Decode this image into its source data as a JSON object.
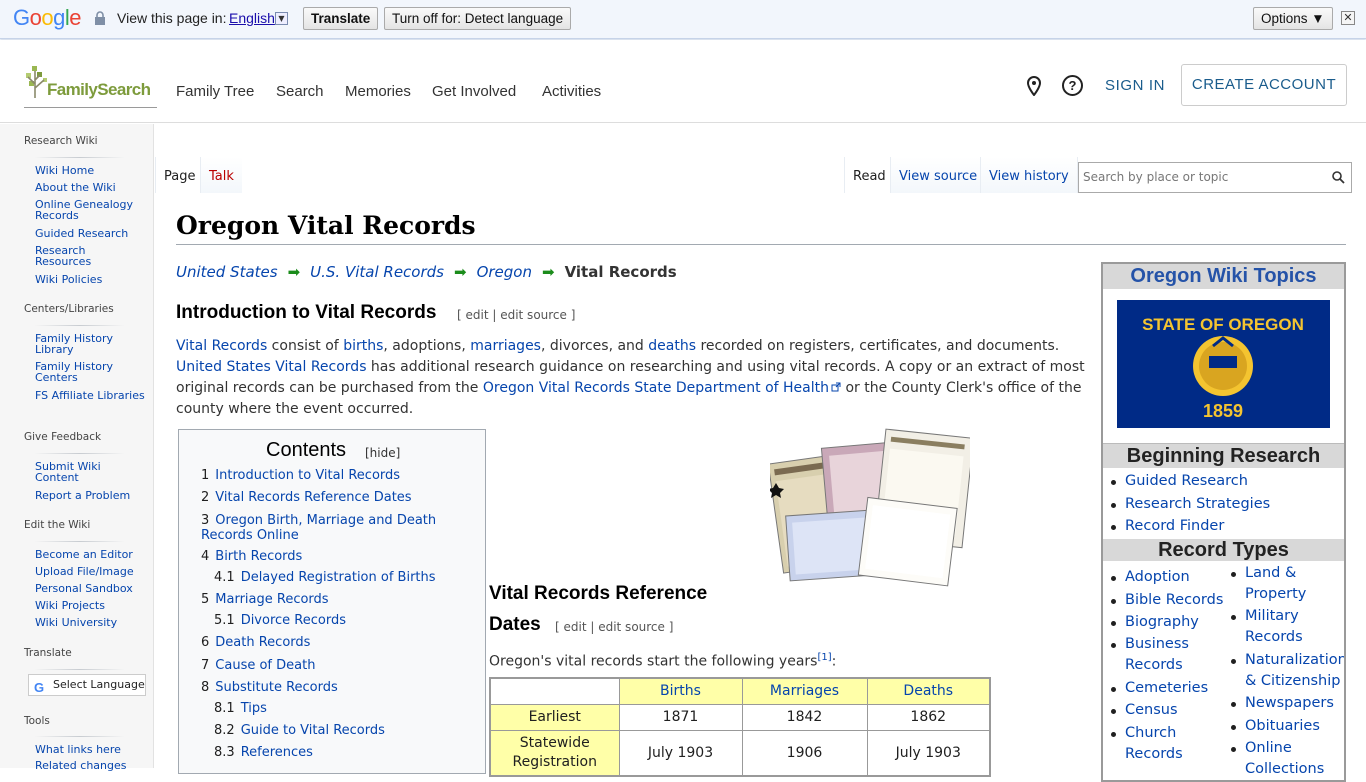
{
  "translate_bar": {
    "view_label": "View this page in:",
    "language": "English",
    "translate_button": "Translate",
    "turn_off_button": "Turn off for: Detect language",
    "options_button": "Options ▼",
    "close": "✕"
  },
  "header": {
    "logo_text": "FamilySearch",
    "nav": [
      "Family Tree",
      "Search",
      "Memories",
      "Get Involved",
      "Activities"
    ],
    "help": "?",
    "sign_in": "SIGN IN",
    "create_account": "CREATE ACCOUNT"
  },
  "sidebar": {
    "research_wiki": "Research Wiki",
    "research_items": [
      "Wiki Home",
      "About the Wiki",
      "Online Genealogy Records",
      "Guided Research",
      "Research Resources",
      "Wiki Policies"
    ],
    "centers": "Centers/Libraries",
    "centers_items": [
      "Family History Library",
      "Family History Centers",
      "FS Affiliate Libraries"
    ],
    "feedback": "Give Feedback",
    "feedback_items": [
      "Submit Wiki Content",
      "Report a Problem"
    ],
    "edit_wiki": "Edit the Wiki",
    "edit_items": [
      "Become an Editor",
      "Upload File/Image",
      "Personal Sandbox",
      "Wiki Projects",
      "Wiki University"
    ],
    "translate": "Translate",
    "select_language": "Select Language",
    "tools": "Tools",
    "tools_items": [
      "What links here",
      "Related changes"
    ]
  },
  "tabs": {
    "page": "Page",
    "talk": "Talk",
    "read": "Read",
    "view_source": "View source",
    "view_history": "View history",
    "search_placeholder": "Search by place or topic"
  },
  "article": {
    "title": "Oregon Vital Records",
    "breadcrumb": [
      "United States",
      "U.S. Vital Records",
      "Oregon"
    ],
    "breadcrumb_current": "Vital Records",
    "arrow": "➡",
    "section1": "Introduction to Vital Records",
    "edit_links": "[ edit | edit source ]",
    "intro": {
      "link1": "Vital Records",
      "t1": " consist of ",
      "link2": "births",
      "t2": ", adoptions, ",
      "link3": "marriages",
      "t3": ", divorces, and ",
      "link4": "deaths",
      "t4": " recorded on registers, certificates, and documents.",
      "link5": "United States Vital Records",
      "t5": " has additional research guidance on researching and using vital records. A copy or an extract of most original records can be purchased from the ",
      "link6": "Oregon Vital Records State Department of Health",
      "t6": " or the County Clerk's office of the county where the event occurred."
    },
    "section2_line1": "Vital Records Reference",
    "section2_line2": "Dates",
    "years_text": "Oregon's vital records start the following years",
    "footnote": "[1]",
    "colon": ":"
  },
  "toc": {
    "title": "Contents",
    "hide": "[hide]",
    "entries": [
      {
        "num": "1",
        "label": "Introduction to Vital Records"
      },
      {
        "num": "2",
        "label": "Vital Records Reference Dates"
      },
      {
        "num": "3",
        "label": "Oregon Birth, Marriage and Death Records Online"
      },
      {
        "num": "4",
        "label": "Birth Records"
      },
      {
        "num": "4.1",
        "label": "Delayed Registration of Births"
      },
      {
        "num": "5",
        "label": "Marriage Records"
      },
      {
        "num": "5.1",
        "label": "Divorce Records"
      },
      {
        "num": "6",
        "label": "Death Records"
      },
      {
        "num": "7",
        "label": "Cause of Death"
      },
      {
        "num": "8",
        "label": "Substitute Records"
      },
      {
        "num": "8.1",
        "label": "Tips"
      },
      {
        "num": "8.2",
        "label": "Guide to Vital Records"
      },
      {
        "num": "8.3",
        "label": "References"
      }
    ]
  },
  "table": {
    "headers": [
      "",
      "Births",
      "Marriages",
      "Deaths"
    ],
    "rows": [
      [
        "Earliest",
        "1871",
        "1842",
        "1862"
      ],
      [
        "Statewide Registration",
        "July 1903",
        "1906",
        "July 1903"
      ]
    ]
  },
  "rightbox": {
    "title": "Oregon Wiki Topics",
    "flag_top": "STATE OF OREGON",
    "flag_year": "1859",
    "beginning": "Beginning Research",
    "beginning_items": [
      "Guided Research",
      "Research Strategies",
      "Record Finder"
    ],
    "record_types": "Record Types",
    "col1": [
      "Adoption",
      "Bible Records",
      "Biography",
      "Business Records",
      "Cemeteries",
      "Census",
      "Church Records"
    ],
    "col2": [
      "Land & Property",
      "Military Records",
      "Naturalization & Citizenship",
      "Newspapers",
      "Obituaries",
      "Online Collections"
    ]
  },
  "colors": {
    "link": "#0645ad",
    "flag_blue": "#002a86",
    "flag_gold": "#f4c430",
    "table_yellow": "#ffffa8"
  }
}
